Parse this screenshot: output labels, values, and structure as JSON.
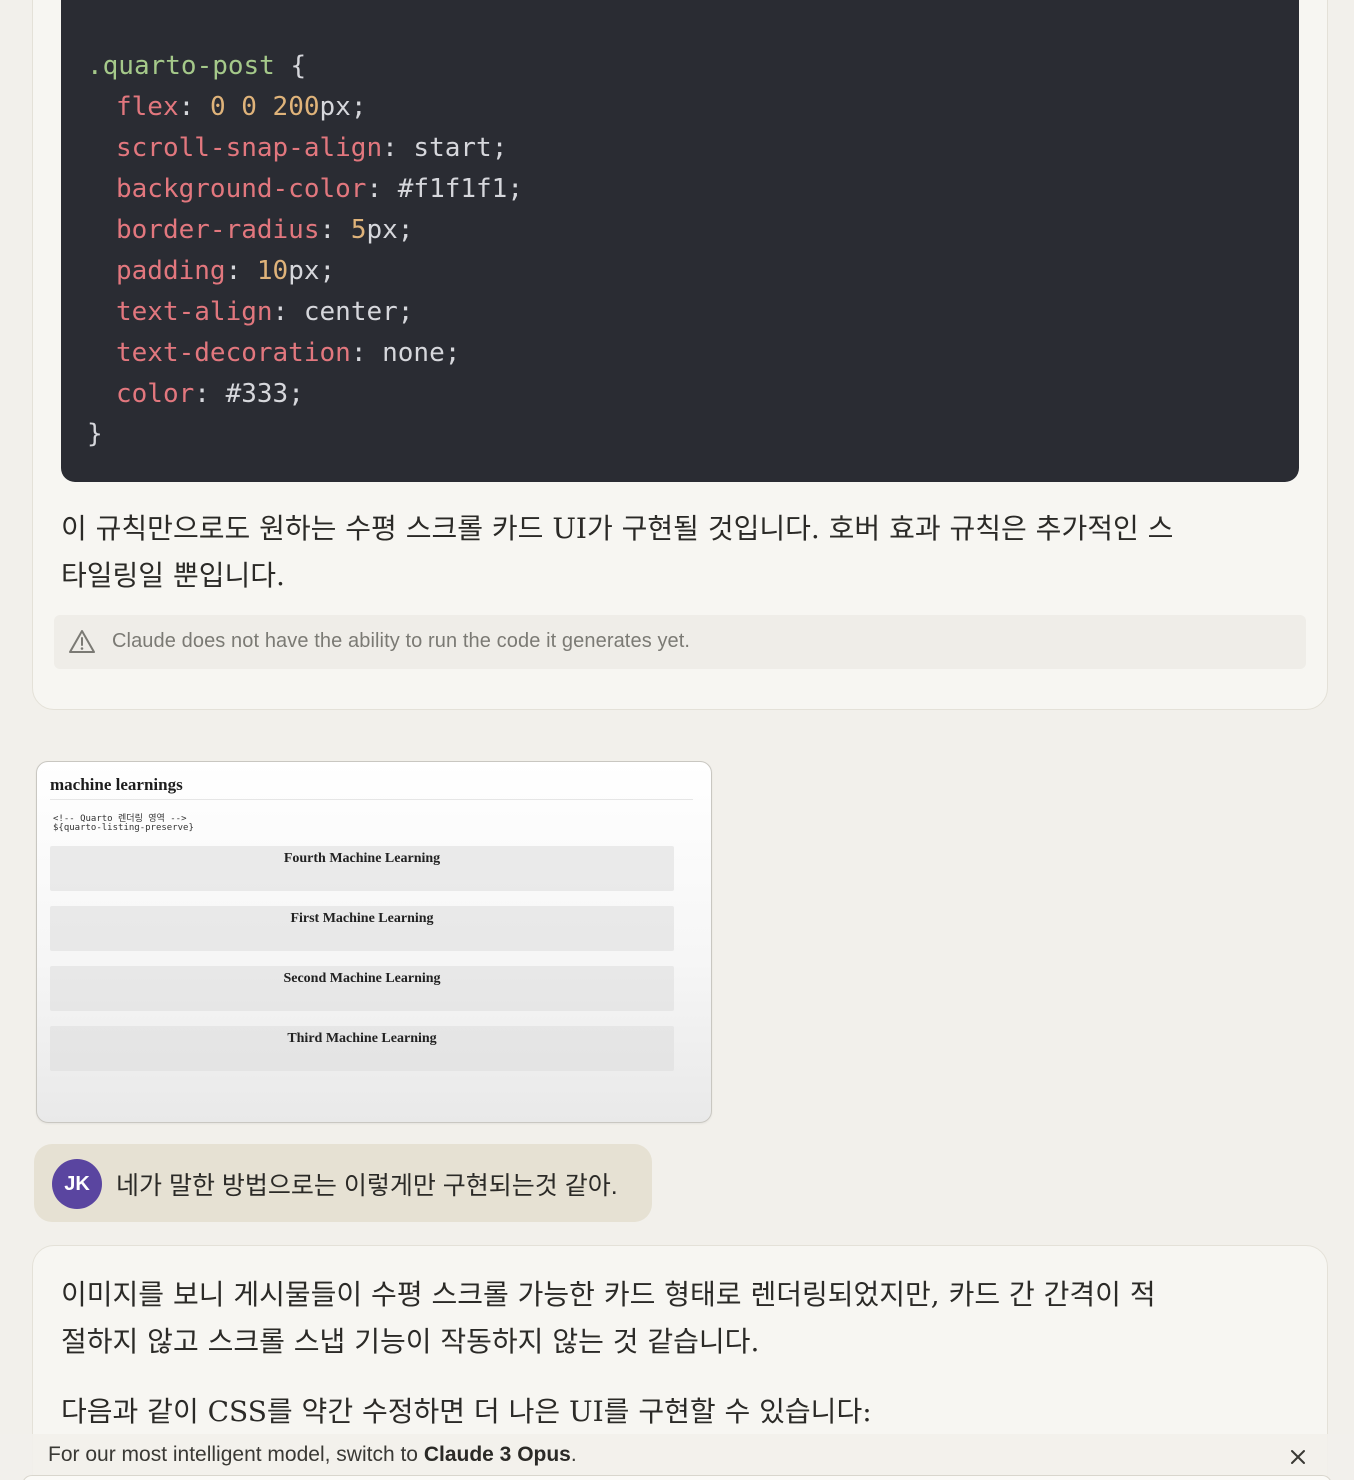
{
  "code_block": {
    "selector": ".quarto-post",
    "open_brace": "{",
    "close_brace": "}",
    "declarations": [
      {
        "property": "flex",
        "value_num": "0 0 200",
        "value_text": "px"
      },
      {
        "property": "scroll-snap-align",
        "value_num": "",
        "value_text": "start"
      },
      {
        "property": "background-color",
        "value_num": "",
        "value_text": "#f1f1f1"
      },
      {
        "property": "border-radius",
        "value_num": "5",
        "value_text": "px"
      },
      {
        "property": "padding",
        "value_num": "10",
        "value_text": "px"
      },
      {
        "property": "text-align",
        "value_num": "",
        "value_text": "center"
      },
      {
        "property": "text-decoration",
        "value_num": "",
        "value_text": "none"
      },
      {
        "property": "color",
        "value_num": "",
        "value_text": "#333"
      }
    ]
  },
  "assistant_1": {
    "paragraph_line1": "이 규칙만으로도 원하는 수평 스크롤 카드 UI가 구현될 것입니다. 호버 효과 규칙은 추가적인 스",
    "paragraph_line2": "타일링일 뿐입니다.",
    "notice": "Claude does not have the ability to run the code it generates yet."
  },
  "attachment": {
    "title": "machine learnings",
    "code_line1": "<!-- Quarto 렌더링 영역 -->",
    "code_line2": "${quarto-listing-preserve}",
    "cards": [
      "Fourth Machine Learning",
      "First Machine Learning",
      "Second Machine Learning",
      "Third Machine Learning"
    ]
  },
  "user_message": {
    "avatar_initials": "JK",
    "text": "네가 말한 방법으로는 이렇게만 구현되는것 같아."
  },
  "assistant_2": {
    "line1": "이미지를 보니 게시물들이 수평 스크롤 가능한 카드 형태로 렌더링되었지만, 카드 간 간격이 적",
    "line2": "절하지 않고 스크롤 스냅 기능이 작동하지 않는 것 같습니다.",
    "line3": "다음과 같이 CSS를 약간 수정하면 더 나은 UI를 구현할 수 있습니다:"
  },
  "banner": {
    "prefix": "For our most intelligent model, switch to ",
    "model_name": "Claude 3 Opus",
    "suffix": "."
  },
  "colors": {
    "page_bg": "#f2f0eb",
    "code_bg": "#2a2c33",
    "avatar_bg": "#5a45a0",
    "user_bubble": "#e6e1d3"
  },
  "icons": [
    "warning-icon",
    "close-icon"
  ]
}
